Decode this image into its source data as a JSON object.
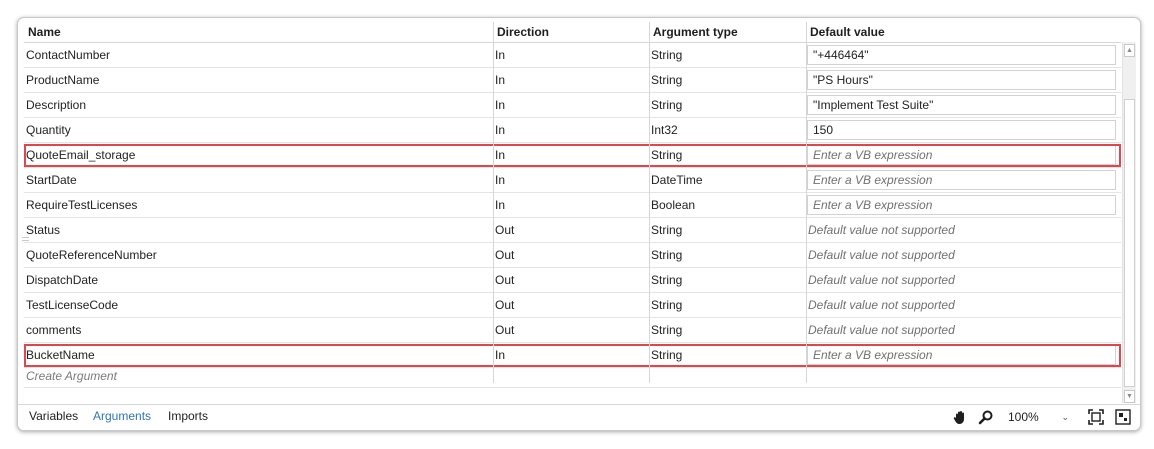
{
  "columns": [
    "Name",
    "Direction",
    "Argument type",
    "Default value"
  ],
  "rows": [
    {
      "name": "ContactNumber",
      "direction": "In",
      "type": "String",
      "default": "\"+446464\"",
      "kind": "value"
    },
    {
      "name": "ProductName",
      "direction": "In",
      "type": "String",
      "default": "\"PS Hours\"",
      "kind": "value"
    },
    {
      "name": "Description",
      "direction": "In",
      "type": "String",
      "default": "\"Implement Test Suite\"",
      "kind": "value"
    },
    {
      "name": "Quantity",
      "direction": "In",
      "type": "Int32",
      "default": "150",
      "kind": "value"
    },
    {
      "name": "QuoteEmail_storage",
      "direction": "In",
      "type": "String",
      "default": "Enter a VB expression",
      "kind": "placeholder",
      "highlight": true
    },
    {
      "name": "StartDate",
      "direction": "In",
      "type": "DateTime",
      "default": "Enter a VB expression",
      "kind": "placeholder"
    },
    {
      "name": "RequireTestLicenses",
      "direction": "In",
      "type": "Boolean",
      "default": "Enter a VB expression",
      "kind": "placeholder"
    },
    {
      "name": "Status",
      "direction": "Out",
      "type": "String",
      "default": "Default value not supported",
      "kind": "unsupported"
    },
    {
      "name": "QuoteReferenceNumber",
      "direction": "Out",
      "type": "String",
      "default": "Default value not supported",
      "kind": "unsupported"
    },
    {
      "name": "DispatchDate",
      "direction": "Out",
      "type": "String",
      "default": "Default value not supported",
      "kind": "unsupported"
    },
    {
      "name": "TestLicenseCode",
      "direction": "Out",
      "type": "String",
      "default": "Default value not supported",
      "kind": "unsupported"
    },
    {
      "name": "comments",
      "direction": "Out",
      "type": "String",
      "default": "Default value not supported",
      "kind": "unsupported"
    },
    {
      "name": "BucketName",
      "direction": "In",
      "type": "String",
      "default": "Enter a VB expression",
      "kind": "placeholder",
      "highlight": true
    }
  ],
  "create_argument": "Create Argument",
  "footer": {
    "tabs": [
      {
        "label": "Variables",
        "active": false
      },
      {
        "label": "Arguments",
        "active": true
      },
      {
        "label": "Imports",
        "active": false
      }
    ],
    "zoom": "100%",
    "icons": [
      "hand-icon",
      "zoom-icon",
      "fit-to-screen-icon",
      "overview-icon"
    ]
  },
  "colors": {
    "highlight": "#e0474c",
    "active_tab": "#2e75b6"
  }
}
